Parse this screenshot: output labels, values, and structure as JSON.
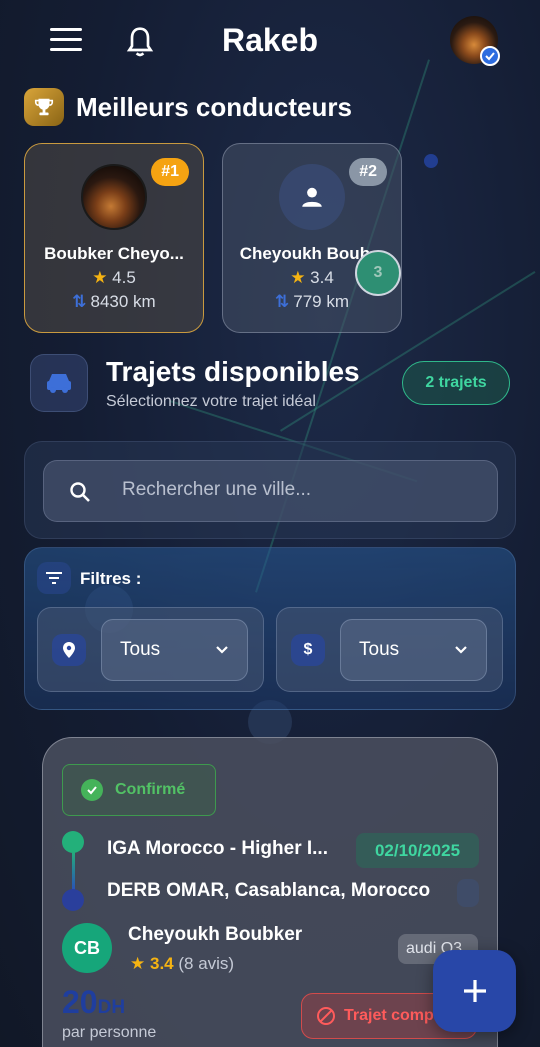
{
  "header": {
    "title": "Rakeb",
    "menu_icon": "menu-icon",
    "bell_icon": "bell-icon"
  },
  "top_drivers": {
    "title": "Meilleurs conducteurs",
    "icon": "trophy-icon",
    "drivers": [
      {
        "rank": "#1",
        "name": "Boubker Cheyo...",
        "rating": "4.5",
        "distance": "8430 km",
        "avatar": "photo"
      },
      {
        "rank": "#2",
        "name": "Cheyoukh Boub...",
        "rating": "3.4",
        "distance": "779 km",
        "avatar": "person-icon"
      }
    ],
    "overlay_badge": "3"
  },
  "trips_section": {
    "title": "Trajets disponibles",
    "subtitle": "Sélectionnez votre trajet idéal",
    "count_badge": "2 trajets",
    "icon": "car-icon"
  },
  "search": {
    "placeholder": "Rechercher une ville..."
  },
  "filters": {
    "label": "Filtres :",
    "location": {
      "icon": "location-pin-icon",
      "value": "Tous"
    },
    "price": {
      "icon": "dollar-icon",
      "icon_text": "$",
      "value": "Tous"
    }
  },
  "trip": {
    "status": "Confirmé",
    "from": "IGA Morocco - Higher I...",
    "to": "DERB OMAR, Casablanca, Morocco",
    "date": "02/10/2025",
    "driver_initials": "CB",
    "driver_name": "Cheyoukh Boubker",
    "rating": "3.4",
    "reviews": "(8 avis)",
    "car": "audi Q3",
    "price": "20",
    "currency": "DH",
    "per_person": "par personne",
    "action_label": "Trajet complet"
  },
  "colors": {
    "accent_green": "#3fd6a0",
    "gold": "#f5a312",
    "primary_blue": "#2847a8",
    "danger": "#ff5b5b"
  }
}
